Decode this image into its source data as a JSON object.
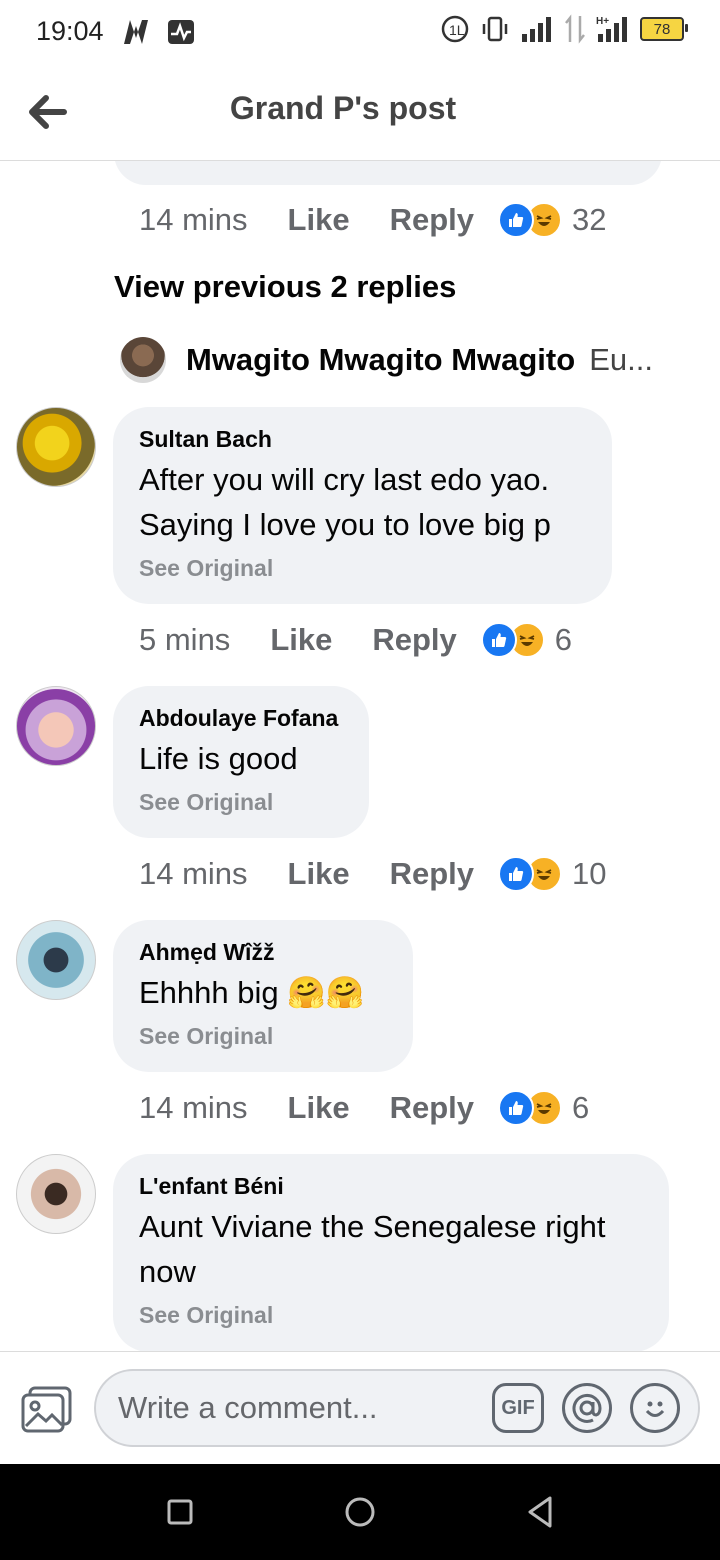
{
  "status": {
    "time": "19:04",
    "battery": "78"
  },
  "header": {
    "title": "Grand P's post"
  },
  "top_meta": {
    "time": "14 mins",
    "like": "Like",
    "reply": "Reply",
    "count": "32"
  },
  "view_previous": "View previous 2 replies",
  "reply_preview": {
    "name": "Mwagito Mwagito Mwagito",
    "snippet": "Eu..."
  },
  "comments": [
    {
      "name": "Sultan Bach",
      "text": "After you will cry last edo yao. Saying I love you to love big p",
      "see_original": "See Original",
      "time": "5 mins",
      "like": "Like",
      "reply": "Reply",
      "count": "6"
    },
    {
      "name": "Abdoulaye Fofana",
      "text": "Life is good",
      "see_original": "See Original",
      "time": "14 mins",
      "like": "Like",
      "reply": "Reply",
      "count": "10"
    },
    {
      "name": "Ahmẹd Wîžž",
      "text": "Ehhhh big 🤗🤗",
      "see_original": "See Original",
      "time": "14 mins",
      "like": "Like",
      "reply": "Reply",
      "count": "6"
    },
    {
      "name": "L'enfant Béni",
      "text": "Aunt Viviane the Senegalese right now",
      "see_original": "See Original"
    }
  ],
  "composer": {
    "placeholder": "Write a comment...",
    "gif": "GIF"
  },
  "colors": {
    "accent": "#1877f2",
    "bubble": "#f0f2f5",
    "haha": "#f7b125"
  },
  "icons": [
    "back-arrow-icon",
    "like-reaction-icon",
    "haha-reaction-icon",
    "photo-icon",
    "gif-icon",
    "mention-icon",
    "emoji-icon"
  ]
}
